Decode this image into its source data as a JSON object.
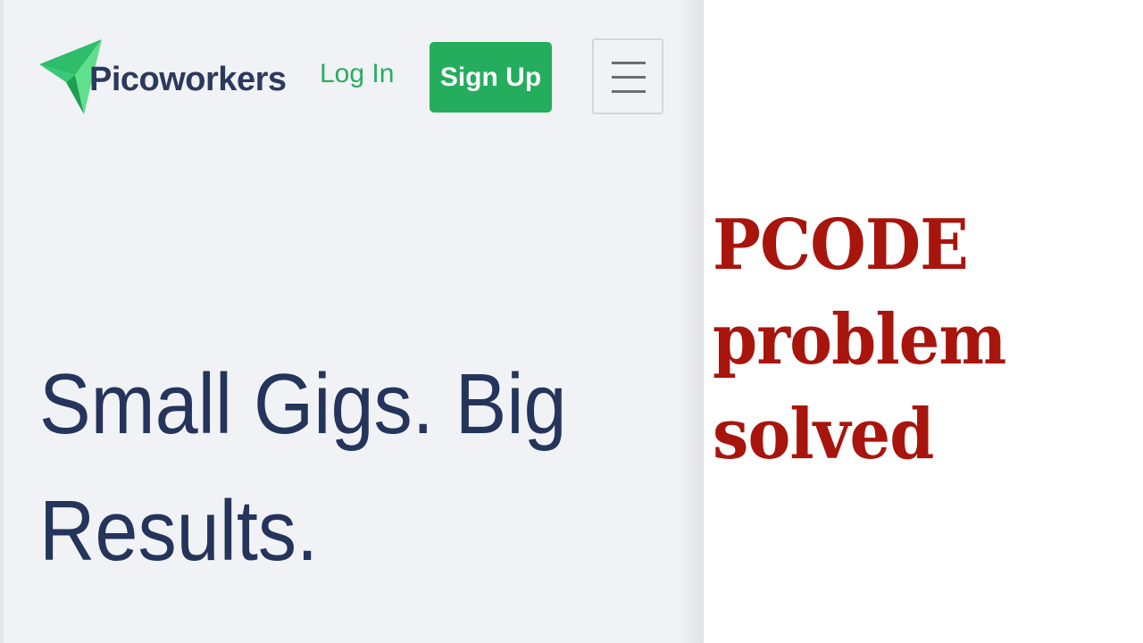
{
  "site": {
    "logo": {
      "text": "Picoworkers",
      "icon": "paper-plane-icon",
      "colors": {
        "dark": "#1e9e52",
        "light": "#5fe08c",
        "text": "#2b3a5c"
      }
    },
    "nav": {
      "login_label": "Log In",
      "signup_label": "Sign Up",
      "menu_icon": "hamburger-menu-icon"
    },
    "hero": {
      "title_line1": "Small Gigs. Big",
      "title_line2": "Results."
    },
    "colors": {
      "accent": "#23ad5c",
      "heading": "#24345b",
      "background": "#f1f2f5"
    }
  },
  "caption": {
    "line1": "PCODE",
    "line2": "problem",
    "line3": "solved",
    "color": "#a8150c"
  }
}
